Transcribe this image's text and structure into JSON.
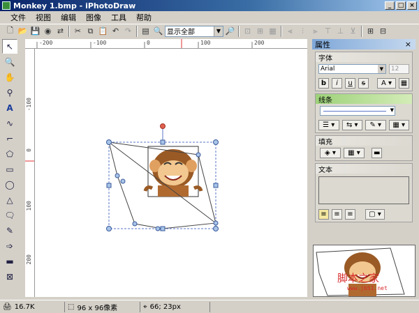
{
  "window": {
    "title": "Monkey 1.bmp - iPhotoDraw",
    "min": "_",
    "max": "□",
    "close": "×"
  },
  "menu": [
    "文件",
    "视图",
    "编辑",
    "图像",
    "工具",
    "帮助"
  ],
  "toolbar": {
    "zoom_value": "显示全部"
  },
  "ruler": {
    "h_labels": [
      "-200",
      "-100",
      "0",
      "100",
      "200"
    ],
    "v_labels": [
      "-100",
      "0",
      "100",
      "200"
    ]
  },
  "panel": {
    "title": "属性",
    "close": "×",
    "font_group": "字体",
    "font_name": "Arial",
    "font_size": "12",
    "bold": "b",
    "italic": "i",
    "underline": "u",
    "strike": "s",
    "font_color": "A",
    "line_group": "线条",
    "fill_group": "填充",
    "text_group": "文本"
  },
  "preview": {
    "watermark": "脚本之家",
    "watermark_url": "www.jb51.net"
  },
  "status": {
    "file_size": "16.7K",
    "dimensions": "96 x 96像素",
    "coords": "66; 23px"
  },
  "colors": {
    "accent_line": "#5a76c8",
    "handle": "#a8c4e8",
    "rotate_handle": "#e06050"
  }
}
